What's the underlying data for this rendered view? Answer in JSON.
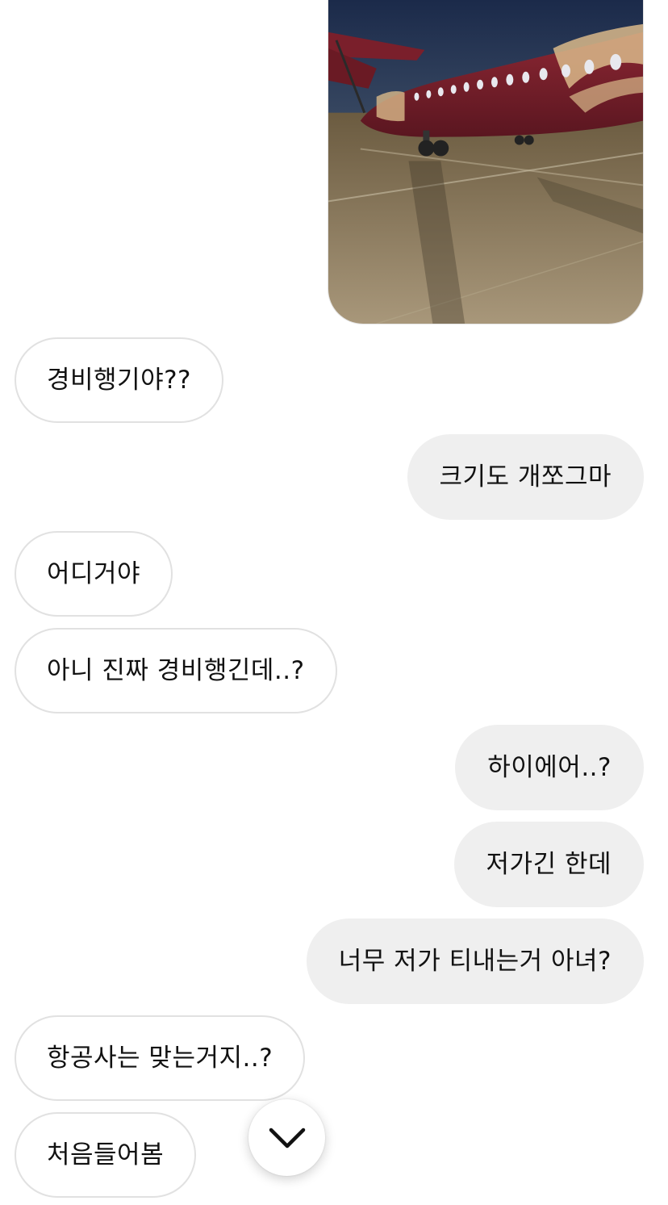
{
  "photo": {
    "description_icon": "airplane-photo",
    "colors": {
      "sky_top": "#1b2a4a",
      "sky_bottom": "#3a4a63",
      "fuselage": "#7a1f2b",
      "livery": "#d9b98a",
      "tarmac": "#8a7a5c"
    }
  },
  "messages": [
    {
      "side": "in",
      "text": "경비행기야??"
    },
    {
      "side": "out",
      "text": "크기도 개쪼그마"
    },
    {
      "side": "in",
      "text": "어디거야"
    },
    {
      "side": "in",
      "text": "아니 진짜 경비행긴데..?"
    },
    {
      "side": "out",
      "text": "하이에어..?"
    },
    {
      "side": "out",
      "text": "저가긴 한데"
    },
    {
      "side": "out",
      "text": "너무 저가 티내는거 아녀?"
    },
    {
      "side": "in",
      "text": "항공사는 맞는거지..?"
    },
    {
      "side": "in",
      "text": "처음들어봄"
    }
  ],
  "scroll_button": {
    "icon": "chevron-down-icon"
  },
  "colors": {
    "incoming_bg": "#ffffff",
    "incoming_border": "#e1e1e1",
    "outgoing_bg": "#efefef",
    "text": "#111111"
  }
}
